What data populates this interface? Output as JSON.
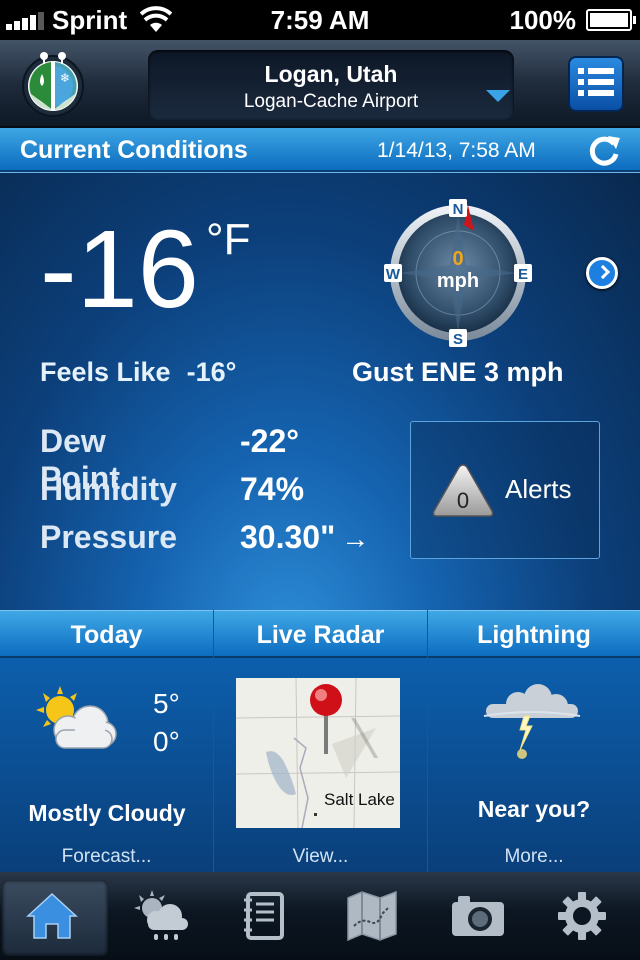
{
  "status": {
    "carrier": "Sprint",
    "time": "7:59 AM",
    "battery": "100%"
  },
  "header": {
    "city": "Logan, Utah",
    "station": "Logan-Cache Airport"
  },
  "current": {
    "title": "Current Conditions",
    "datetime": "1/14/13, 7:58 AM",
    "temp": "-16",
    "unit": "°F",
    "feels_label": "Feels Like",
    "feels_value": "-16°",
    "wind_speed": "0",
    "wind_unit": "mph",
    "compass": {
      "n": "N",
      "e": "E",
      "s": "S",
      "w": "W"
    },
    "gust": "Gust ENE 3 mph",
    "dew_label": "Dew Point",
    "dew_value": "-22°",
    "humidity_label": "Humidity",
    "humidity_value": "74%",
    "pressure_label": "Pressure",
    "pressure_value": "30.30\"",
    "pressure_arrow": "→",
    "alerts_count": "0",
    "alerts_label": "Alerts"
  },
  "tiles": {
    "today": {
      "title": "Today",
      "high": "5°",
      "low": "0°",
      "desc": "Mostly Cloudy",
      "footer": "Forecast..."
    },
    "radar": {
      "title": "Live Radar",
      "map_label": "Salt Lake",
      "footer": "View..."
    },
    "lightning": {
      "title": "Lightning",
      "desc": "Near you?",
      "footer": "More..."
    }
  },
  "tabs": [
    {
      "icon": "home-icon"
    },
    {
      "icon": "forecast-icon"
    },
    {
      "icon": "notebook-icon"
    },
    {
      "icon": "map-icon"
    },
    {
      "icon": "camera-icon"
    },
    {
      "icon": "gear-icon"
    }
  ],
  "colors": {
    "accent": "#1a7bd4",
    "compass_needle": "#d0141e",
    "wind_speed": "#f0a61a"
  }
}
